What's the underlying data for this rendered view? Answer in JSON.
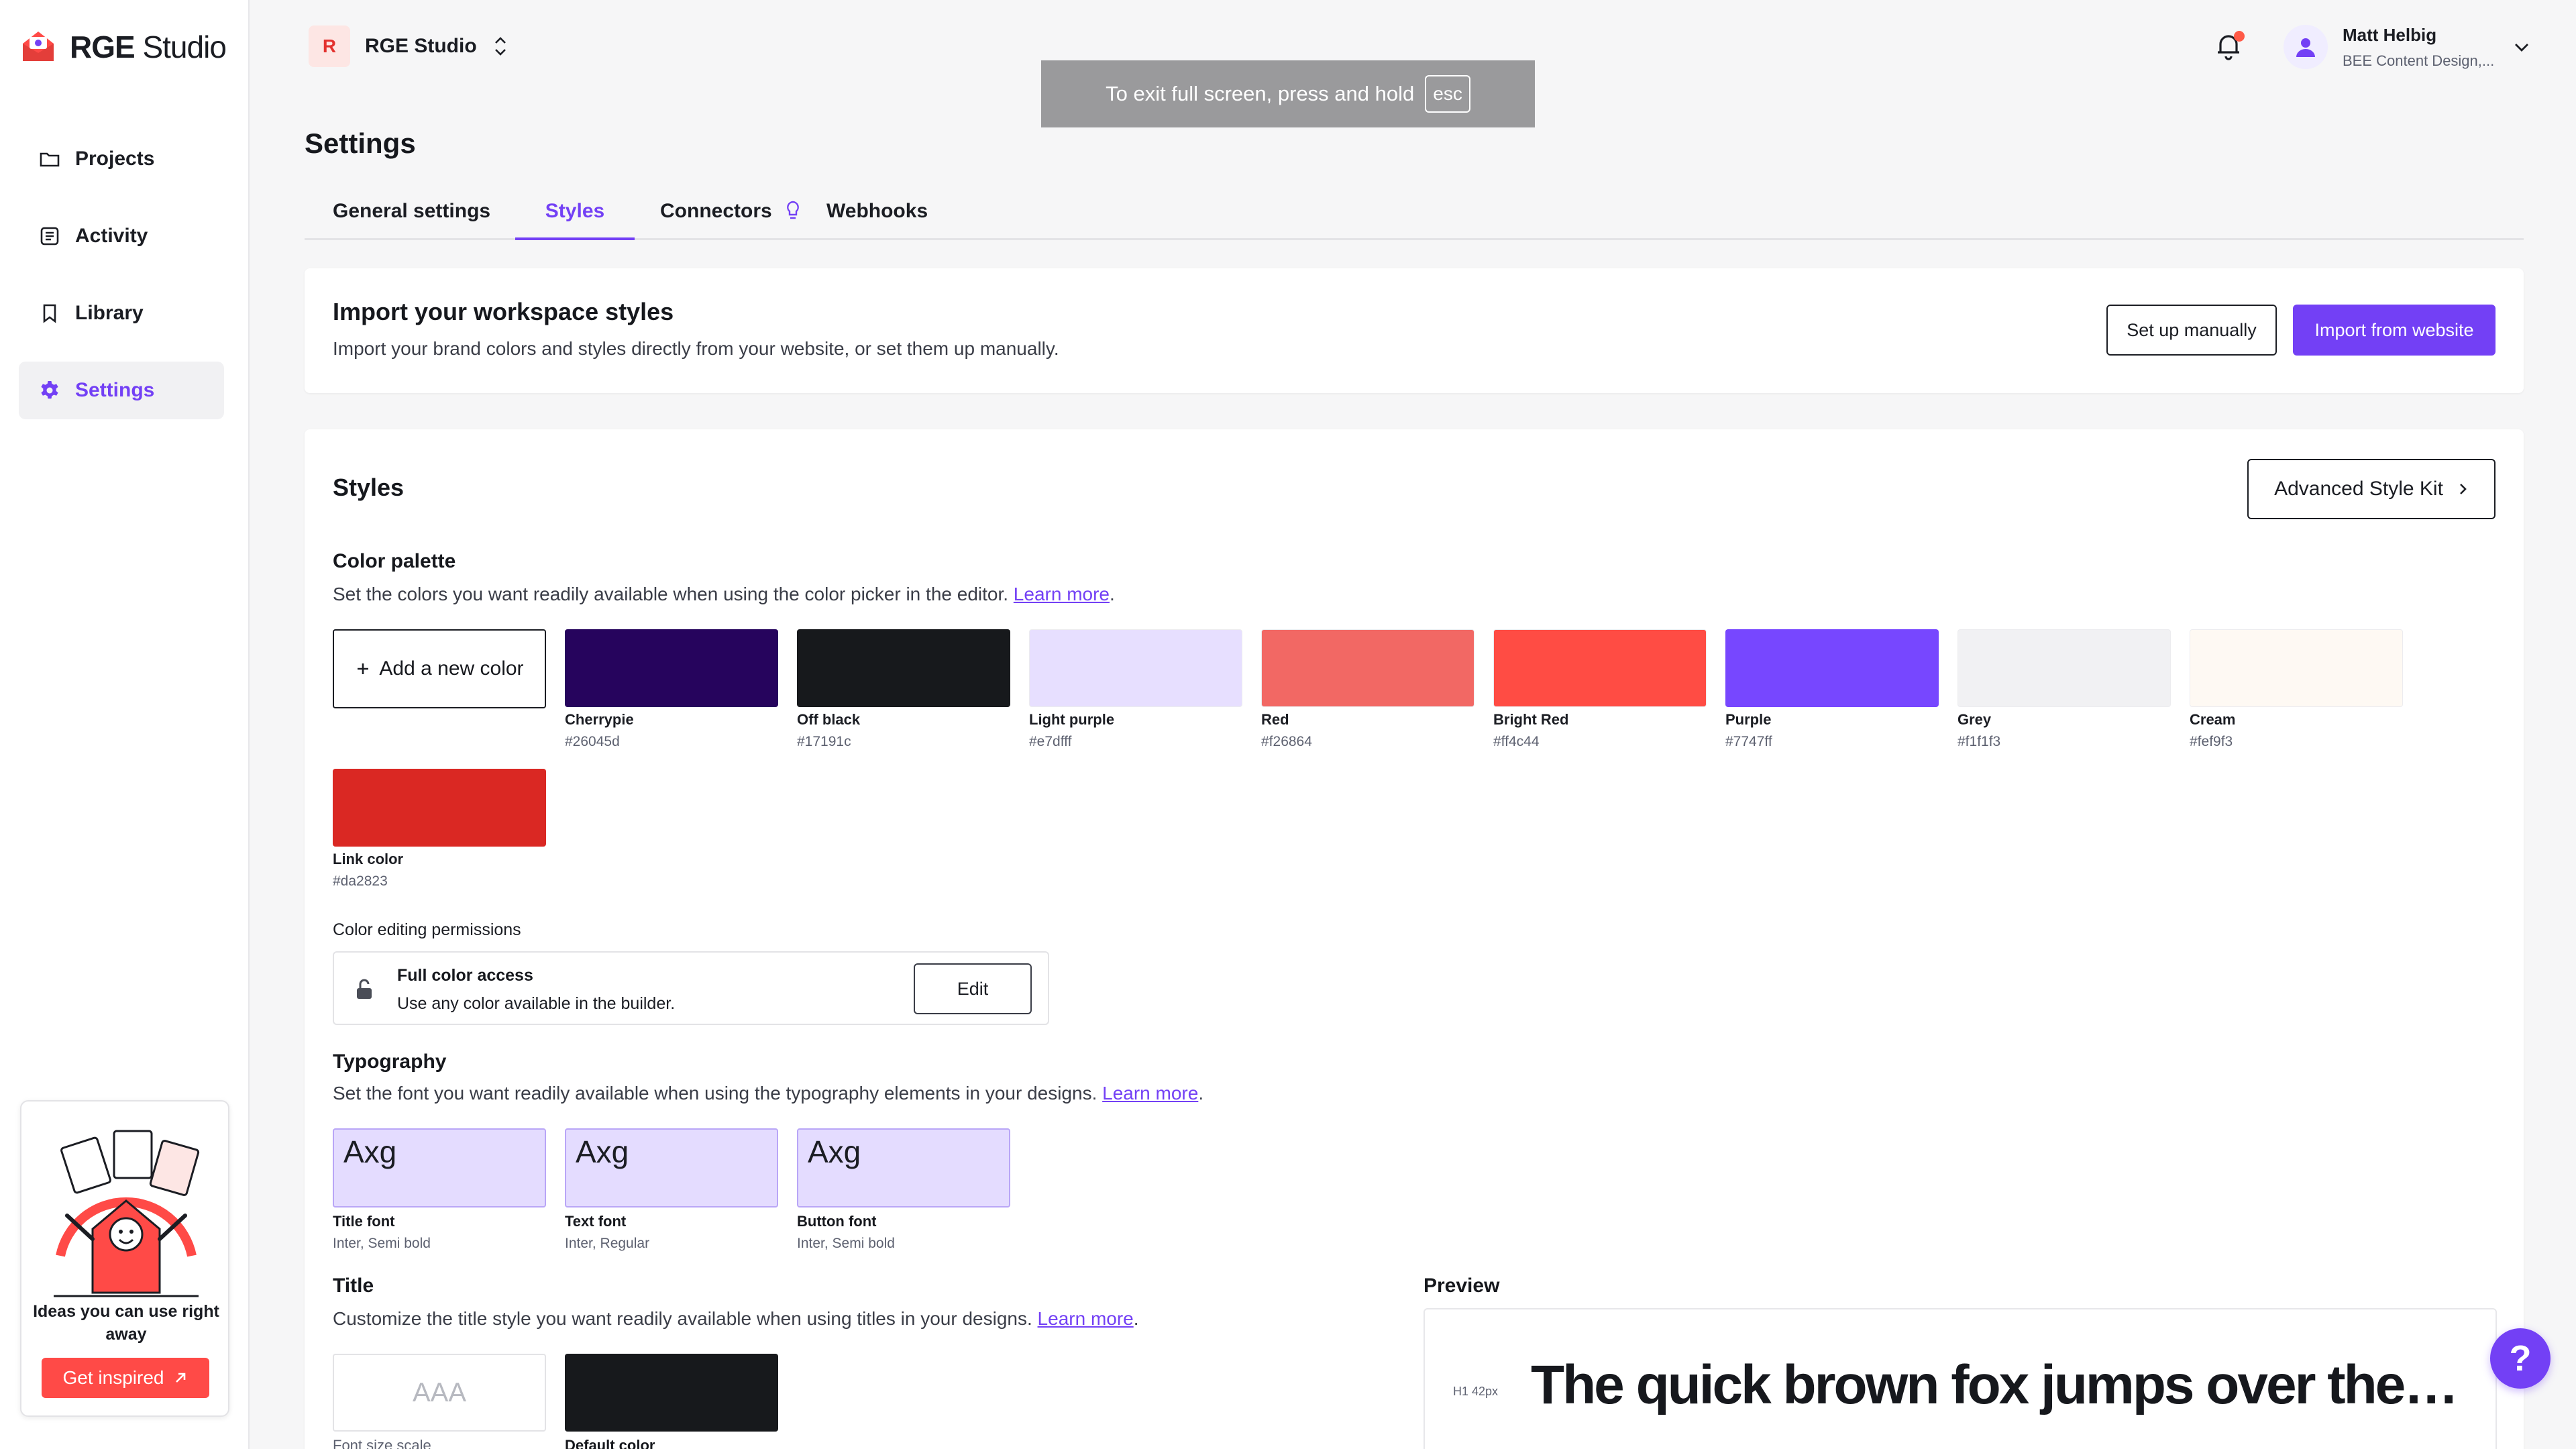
{
  "app": {
    "brand_bold": "RGE",
    "brand_light": " Studio",
    "workspace_initial": "R",
    "workspace_name": "RGE Studio"
  },
  "sidebar": {
    "items": [
      {
        "label": "Projects",
        "icon": "folder-icon"
      },
      {
        "label": "Activity",
        "icon": "activity-icon"
      },
      {
        "label": "Library",
        "icon": "bookmark-icon"
      },
      {
        "label": "Settings",
        "icon": "gear-icon",
        "active": true
      }
    ],
    "promo": {
      "text": "Ideas you can use right away",
      "button": "Get inspired"
    }
  },
  "user": {
    "name": "Matt Helbig",
    "org": "BEE Content Design,..."
  },
  "fullscreen_notice": {
    "text": "To exit full screen, press and hold",
    "key": "esc"
  },
  "page": {
    "title": "Settings"
  },
  "tabs": [
    {
      "label": "General settings"
    },
    {
      "label": "Styles",
      "active": true
    },
    {
      "label": "Connectors"
    },
    {
      "label": "Webhooks"
    }
  ],
  "import": {
    "title": "Import your workspace styles",
    "description": "Import your brand colors and styles directly from your website, or set them up manually.",
    "manual_button": "Set up manually",
    "import_button": "Import from website"
  },
  "styles": {
    "title": "Styles",
    "advanced_button": "Advanced Style Kit",
    "palette": {
      "title": "Color palette",
      "description": "Set the colors you want readily available when using the color picker in the editor.",
      "learn_more": "Learn more",
      "add_label": "Add a new color",
      "colors": [
        {
          "name": "Cherrypie",
          "hex": "#26045d"
        },
        {
          "name": "Off black",
          "hex": "#17191c"
        },
        {
          "name": "Light purple",
          "hex": "#e7dfff"
        },
        {
          "name": "Red",
          "hex": "#f26864"
        },
        {
          "name": "Bright Red",
          "hex": "#ff4c44"
        },
        {
          "name": "Purple",
          "hex": "#7747ff"
        },
        {
          "name": "Grey",
          "hex": "#f1f1f3"
        },
        {
          "name": "Cream",
          "hex": "#fef9f3"
        },
        {
          "name": "Link color",
          "hex": "#da2823"
        }
      ]
    },
    "permissions": {
      "label": "Color editing permissions",
      "title": "Full color access",
      "description": "Use any color available in the builder.",
      "edit_button": "Edit"
    },
    "typography": {
      "title": "Typography",
      "description": "Set the font you want readily available when using the typography elements in your designs.",
      "learn_more": "Learn more",
      "fonts": [
        {
          "sample": "Axg",
          "name": "Title font",
          "spec": "Inter, Semi bold"
        },
        {
          "sample": "Axg",
          "name": "Text font",
          "spec": "Inter, Regular"
        },
        {
          "sample": "Axg",
          "name": "Button font",
          "spec": "Inter, Semi bold"
        }
      ]
    },
    "title_style": {
      "title": "Title",
      "description": "Customize the title style you want readily available when using titles in your designs.",
      "learn_more": "Learn more",
      "scale_sample": "AAA",
      "scale_label": "Font size scale",
      "color_label": "Default color",
      "default_color": "#17191c"
    },
    "preview": {
      "title": "Preview",
      "tag": "H1 42px",
      "text": "The quick brown fox jumps over the lazy dog"
    }
  },
  "help": {
    "label": "?"
  }
}
